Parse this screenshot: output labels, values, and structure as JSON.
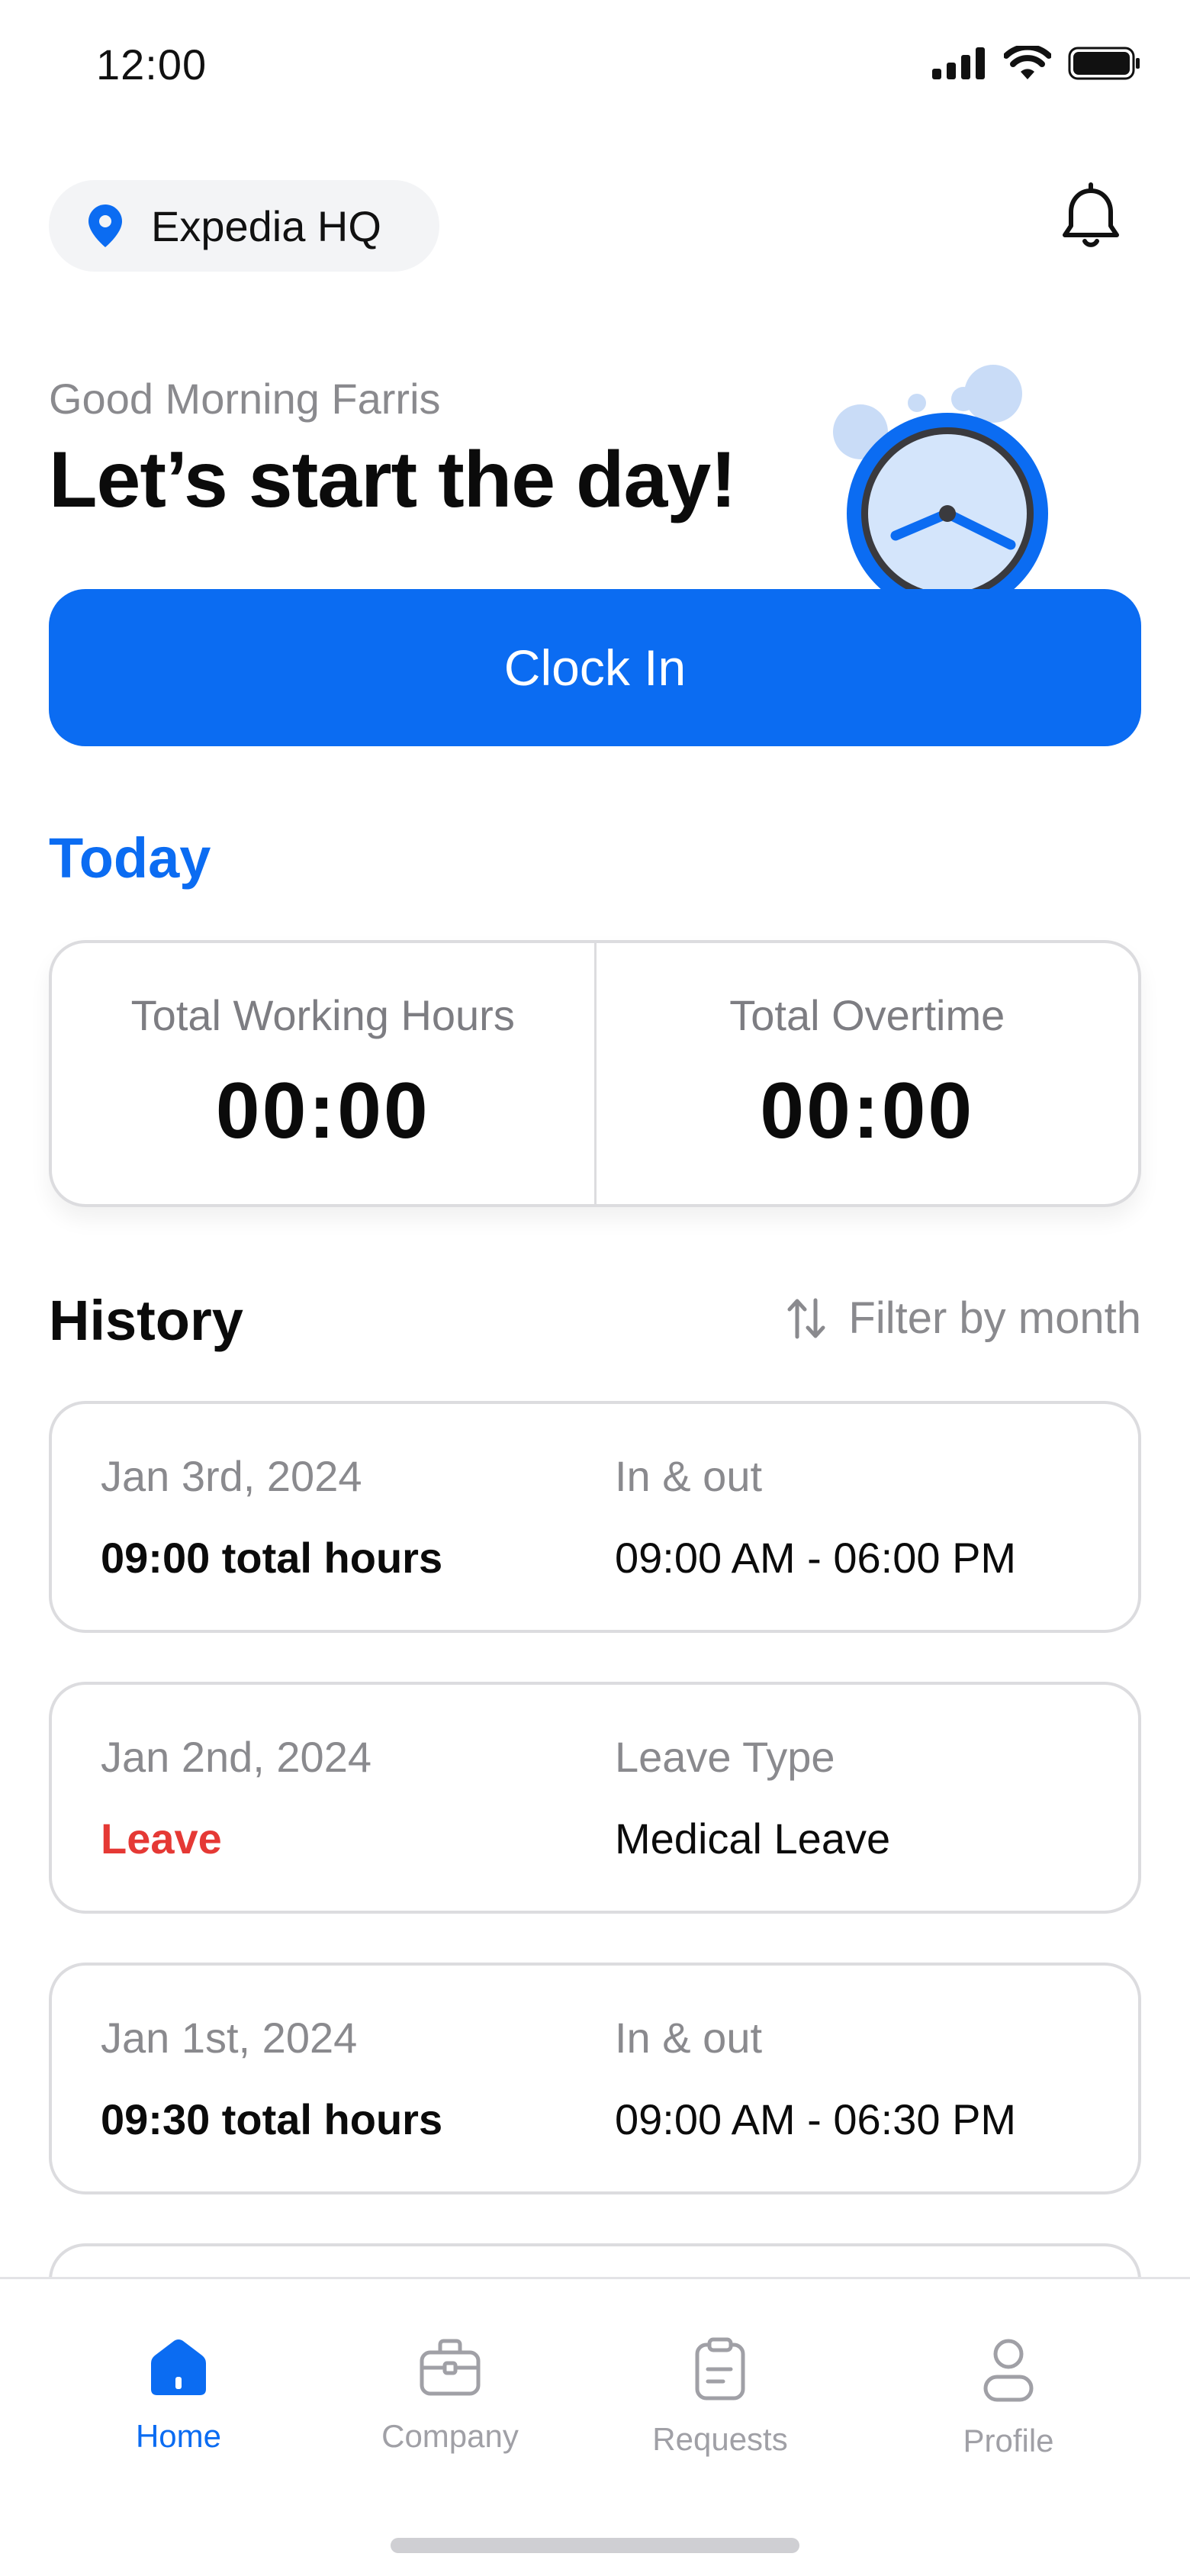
{
  "status_bar": {
    "time": "12:00"
  },
  "header": {
    "location": "Expedia HQ"
  },
  "greeting": {
    "subtitle": "Good Morning Farris",
    "title": "Let’s start the day!"
  },
  "actions": {
    "clock_in": "Clock In"
  },
  "today": {
    "title": "Today",
    "stats": [
      {
        "label": "Total Working Hours",
        "value": "00:00"
      },
      {
        "label": "Total Overtime",
        "value": "00:00"
      }
    ]
  },
  "history": {
    "title": "History",
    "filter_label": "Filter by month",
    "items": [
      {
        "date": "Jan 3rd, 2024",
        "summary": "09:00 total hours",
        "right_label": "In & out",
        "right_value": "09:00 AM - 06:00 PM"
      },
      {
        "date": "Jan 2nd, 2024",
        "summary": "Leave",
        "right_label": "Leave Type",
        "right_value": "Medical Leave"
      },
      {
        "date": "Jan 1st, 2024",
        "summary": "09:30 total hours",
        "right_label": "In & out",
        "right_value": "09:00 AM - 06:30 PM"
      }
    ]
  },
  "nav": {
    "items": [
      {
        "label": "Home",
        "icon": "home-icon",
        "active": true
      },
      {
        "label": "Company",
        "icon": "briefcase-icon",
        "active": false
      },
      {
        "label": "Requests",
        "icon": "clipboard-icon",
        "active": false
      },
      {
        "label": "Profile",
        "icon": "user-icon",
        "active": false
      }
    ]
  },
  "colors": {
    "primary": "#0b6cf2",
    "leave": "#e53935",
    "muted": "#8a8a8e"
  }
}
